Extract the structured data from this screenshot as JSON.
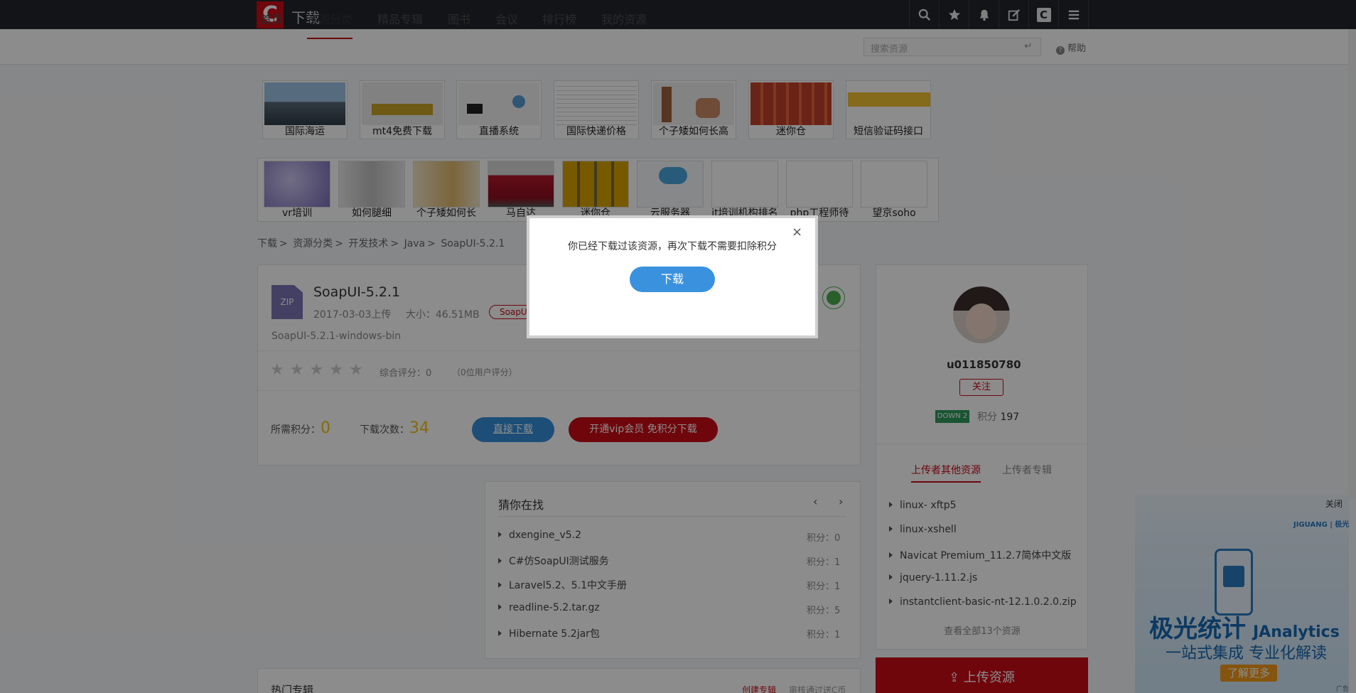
{
  "header": {
    "logo_letter": "C",
    "title": "下载"
  },
  "nav": {
    "items": [
      "首页",
      "资源分类",
      "精品专辑",
      "图书",
      "会议",
      "排行榜",
      "我的资源"
    ],
    "active_index": 1,
    "search_placeholder": "搜索资源",
    "help": "帮助"
  },
  "ads_row1": [
    "国际海运",
    "mt4免费下载",
    "直播系统",
    "国际快递价格",
    "个子矮如何长高",
    "迷你仓",
    "短信验证码接口"
  ],
  "ads_row2": [
    "vr培训",
    "如何腿细",
    "个子矮如何长",
    "马自达",
    "迷你仓",
    "云服务器",
    "it培训机构排名",
    "php工程师待",
    "望京soho"
  ],
  "breadcrumb": [
    "下载",
    "资源分类",
    "开发技术",
    "Java",
    "SoapUI-5.2.1"
  ],
  "resource": {
    "icon_label": "ZIP",
    "title": "SoapUI-5.2.1",
    "upload_date": "2017-03-03上传",
    "size": "大小：46.51MB",
    "tag": "SoapUI",
    "description": "SoapUI-5.2.1-windows-bin",
    "rating_text": "综合评分：0",
    "rating_count": "（0位用户评分）",
    "points_label": "所需积分：",
    "points_value": "0",
    "downloads_label": "下载次数：",
    "downloads_value": "34",
    "direct_download": "直接下载",
    "vip_download": "开通vip会员 免积分下载"
  },
  "guess": {
    "title": "猜你在找",
    "items": [
      {
        "name": "dxengine_v5.2",
        "points": "积分：0"
      },
      {
        "name": "C#仿SoapUI测试服务",
        "points": "积分：1"
      },
      {
        "name": "Laravel5.2、5.1中文手册",
        "points": "积分：1"
      },
      {
        "name": "readline-5.2.tar.gz",
        "points": "积分：5"
      },
      {
        "name": "Hibernate 5.2jar包",
        "points": "积分：1"
      }
    ]
  },
  "hot": {
    "title": "热门专辑",
    "create": "创建专辑",
    "audit": "审核通过送C币"
  },
  "uploader": {
    "username": "u011850780",
    "follow": "关注",
    "level_badge": "DOWN 2",
    "points_label": "积分",
    "points_value": "197",
    "tabs": [
      "上传者其他资源",
      "上传者专辑"
    ],
    "items": [
      "linux- xftp5",
      "linux-xshell",
      "Navicat Premium_11.2.7简体中文版",
      "jquery-1.11.2.js",
      "instantclient-basic-nt-12.1.0.2.0.zip"
    ],
    "view_all": "查看全部13个资源",
    "upload_button": "上传资源"
  },
  "ad": {
    "close": "关闭",
    "brand": "JIGUANG | 极光",
    "headline": "极光统计",
    "headline_en": "JAnalytics",
    "subline": "一站式集成  专业化解读",
    "cta": "了解更多",
    "flag": "广告"
  },
  "modal": {
    "message": "你已经下载过该资源，再次下载不需要扣除积分",
    "button": "下载",
    "close": "×"
  },
  "colors": {
    "brand_red": "#ca0c16",
    "topbar": "#23262d",
    "primary_blue": "#348eda",
    "gold": "#f1c40f"
  }
}
